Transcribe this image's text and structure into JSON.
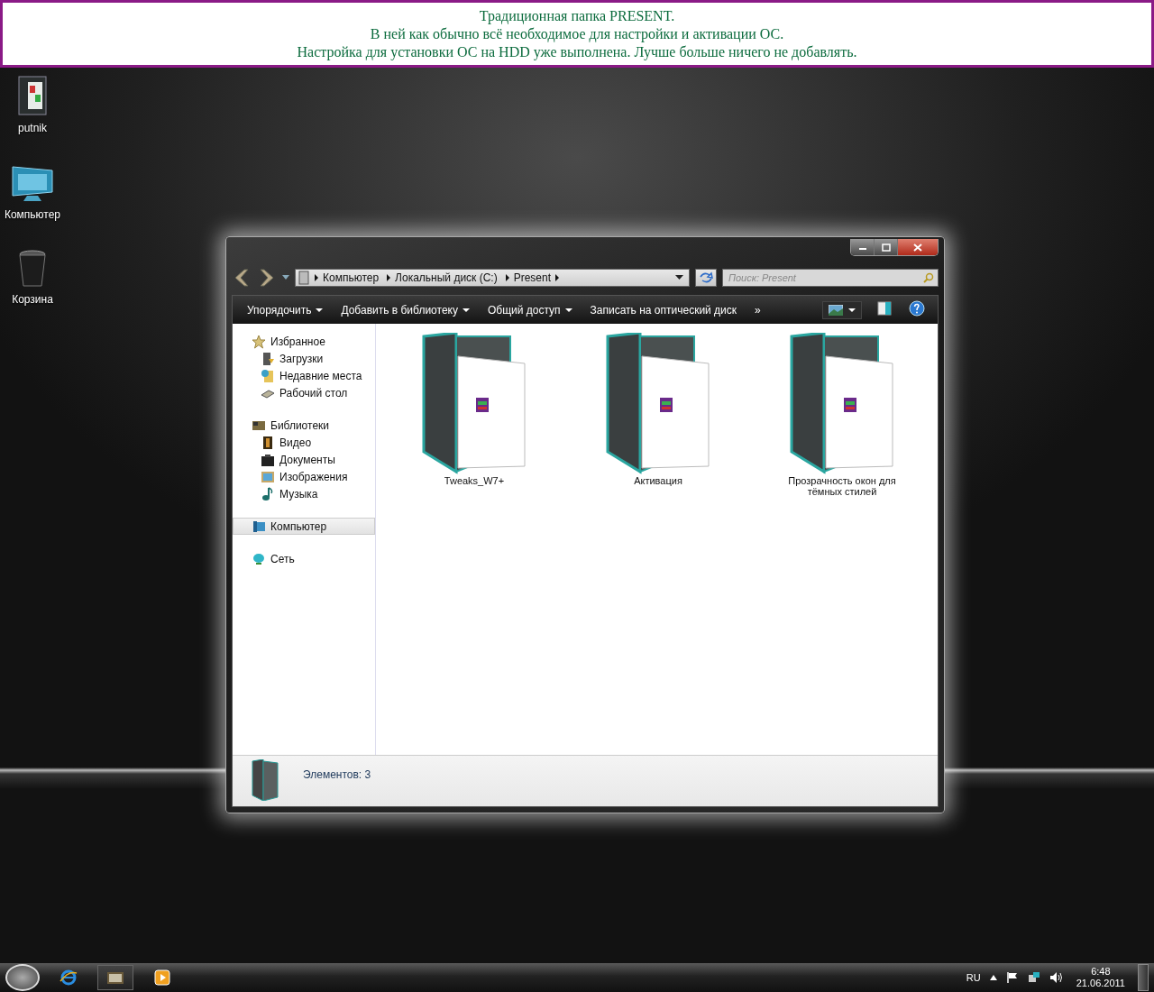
{
  "banner": {
    "lines": [
      "Традиционная папка PRESENT.",
      "В ней как обычно всё необходимое для настройки и активации ОС.",
      "Настройка для установки ОС на HDD уже выполнена. Лучше больше ничего не добавлять."
    ]
  },
  "desktop_icons": [
    {
      "kind": "archive",
      "label": "putnik"
    },
    {
      "kind": "computer",
      "label": "Компьютер"
    },
    {
      "kind": "trash",
      "label": "Корзина"
    }
  ],
  "window": {
    "breadcrumb": [
      "Компьютер",
      "Локальный диск (C:)",
      "Present"
    ],
    "search": {
      "placeholder": "Поиск: Present"
    },
    "toolbar": [
      {
        "label": "Упорядочить",
        "dropdown": true
      },
      {
        "label": "Добавить в библиотеку",
        "dropdown": true
      },
      {
        "label": "Общий доступ",
        "dropdown": true
      },
      {
        "label": "Записать на оптический диск",
        "dropdown": false
      },
      {
        "label": "»",
        "dropdown": false
      }
    ],
    "nav": [
      {
        "kind": "star",
        "label": "Избранное",
        "selected": false,
        "children": [
          {
            "kind": "download",
            "label": "Загрузки",
            "selected": false
          },
          {
            "kind": "recent",
            "label": "Недавние места",
            "selected": false
          },
          {
            "kind": "desktop",
            "label": "Рабочий стол",
            "selected": false
          }
        ]
      },
      {
        "kind": "library",
        "label": "Библиотеки",
        "selected": false,
        "children": [
          {
            "kind": "video",
            "label": "Видео",
            "selected": false
          },
          {
            "kind": "docs",
            "label": "Документы",
            "selected": false
          },
          {
            "kind": "image",
            "label": "Изображения",
            "selected": false
          },
          {
            "kind": "music",
            "label": "Музыка",
            "selected": false
          }
        ]
      },
      {
        "kind": "computer",
        "label": "Компьютер",
        "selected": true
      },
      {
        "kind": "network",
        "label": "Сеть",
        "selected": false
      }
    ],
    "items": [
      {
        "label": "Tweaks_W7+"
      },
      {
        "label": "Активация"
      },
      {
        "label": "Прозрачность окон для тёмных стилей"
      }
    ],
    "status": "Элементов: 3"
  },
  "taskbar": {
    "apps": [
      {
        "kind": "browser",
        "selected": false
      },
      {
        "kind": "explorer",
        "selected": true
      },
      {
        "kind": "player",
        "selected": false
      }
    ],
    "language": "RU",
    "time": "6:48",
    "date": "21.06.2011"
  }
}
